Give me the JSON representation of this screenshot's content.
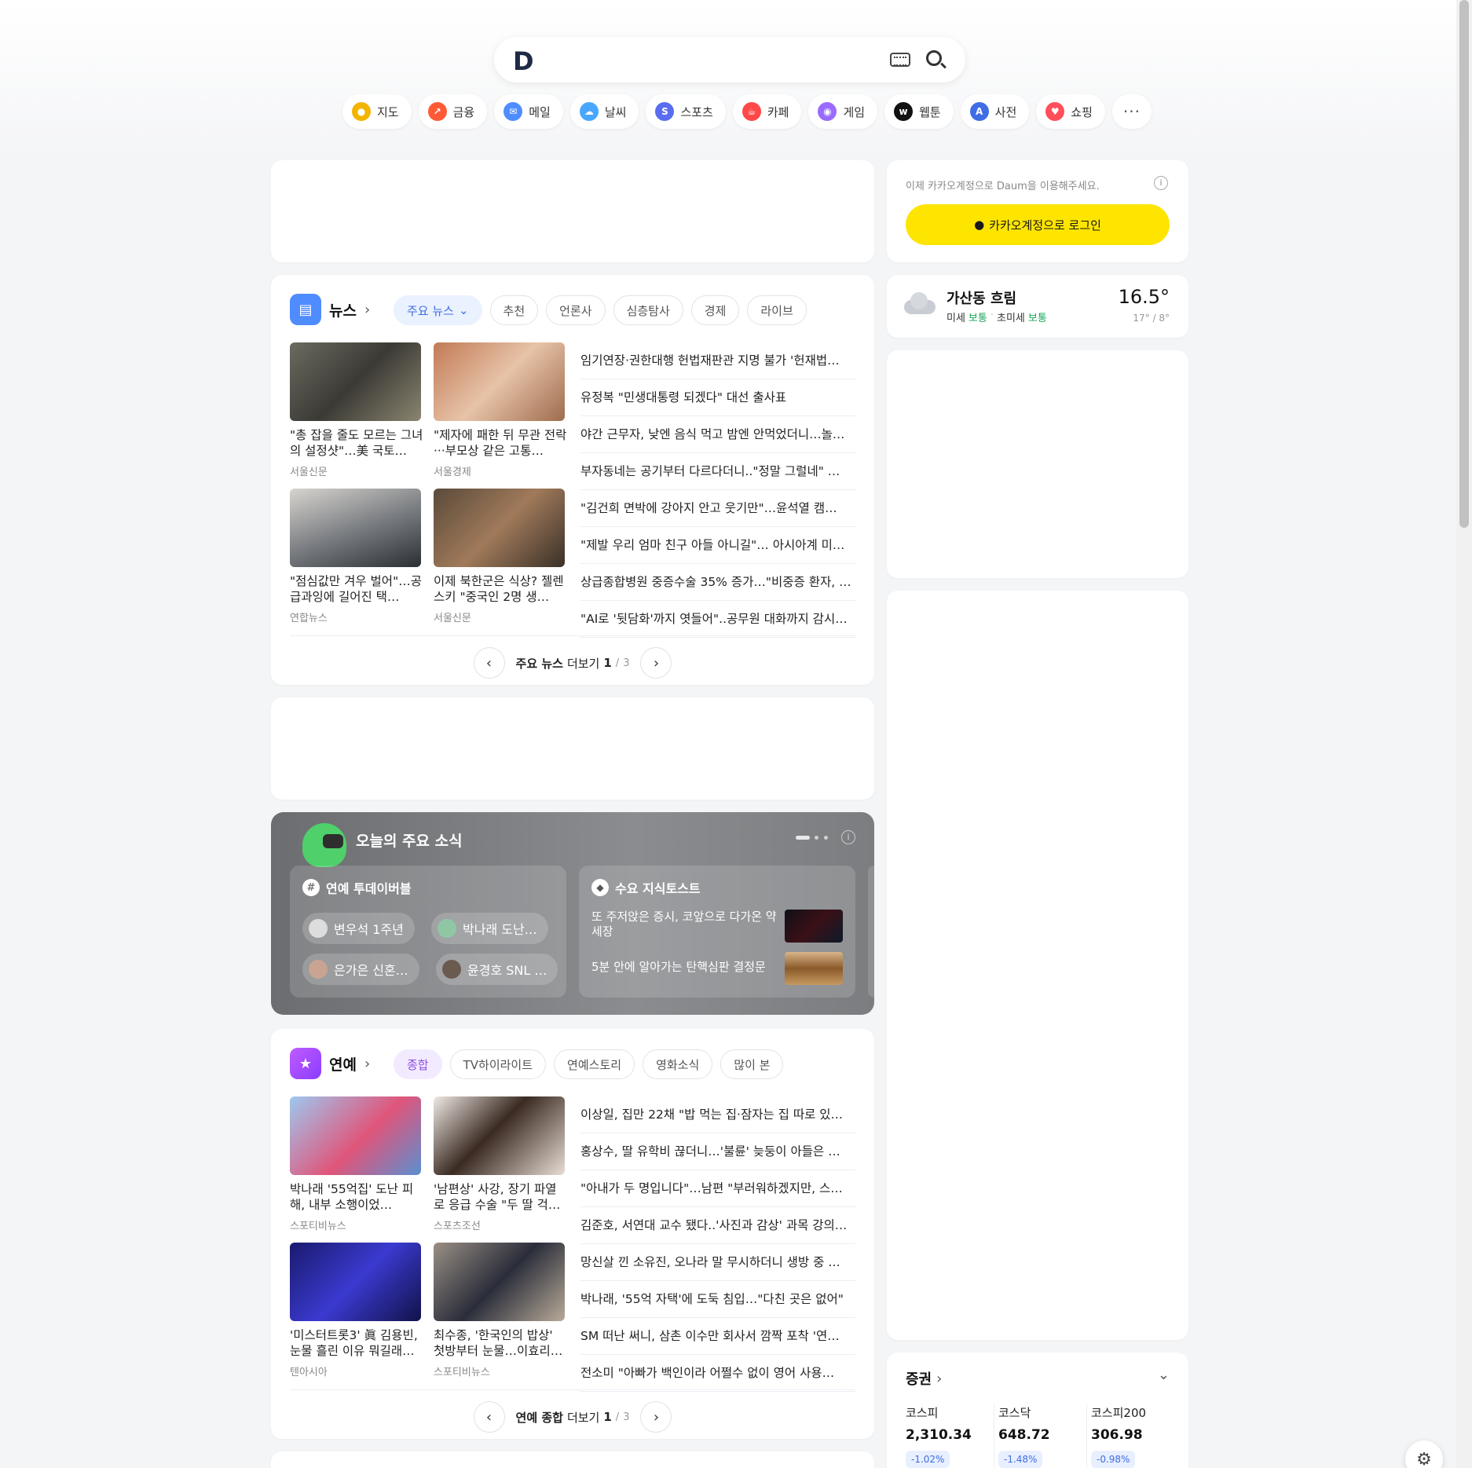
{
  "search": {
    "logo": "D"
  },
  "services": [
    {
      "label": "지도",
      "icon": "map-pin-icon",
      "color": "#f3b400",
      "glyph": "●"
    },
    {
      "label": "금융",
      "icon": "finance-icon",
      "color": "#ff5a36",
      "glyph": "↗"
    },
    {
      "label": "메일",
      "icon": "mail-icon",
      "color": "#4f8cff",
      "glyph": "✉"
    },
    {
      "label": "날씨",
      "icon": "weather-icon",
      "color": "#47a7ff",
      "glyph": "☁"
    },
    {
      "label": "스포츠",
      "icon": "sports-icon",
      "color": "#5a6cf0",
      "glyph": "S"
    },
    {
      "label": "카페",
      "icon": "cafe-icon",
      "color": "#ff4848",
      "glyph": "☕"
    },
    {
      "label": "게임",
      "icon": "game-icon",
      "color": "#9a6bff",
      "glyph": "◉"
    },
    {
      "label": "웹툰",
      "icon": "webtoon-icon",
      "color": "#111111",
      "glyph": "w"
    },
    {
      "label": "사전",
      "icon": "dictionary-icon",
      "color": "#3e6de4",
      "glyph": "A"
    },
    {
      "label": "쇼핑",
      "icon": "shopping-icon",
      "color": "#ff4f5a",
      "glyph": "♥"
    }
  ],
  "more_label": "···",
  "news": {
    "title": "뉴스",
    "tabs": [
      "주요 뉴스",
      "추천",
      "언론사",
      "심층탐사",
      "경제",
      "라이브"
    ],
    "cards": [
      {
        "caption": "\"총 잡을 줄도 모르는 그녀의 설정샷\"…美 국토…",
        "source": "서울신문"
      },
      {
        "caption": "\"제자에 패한 뒤 무관 전락···부모상 같은 고통…",
        "source": "서울경제"
      },
      {
        "caption": "\"점심값만 겨우 벌어\"…공급과잉에 길어진 택…",
        "source": "연합뉴스"
      },
      {
        "caption": "이제 북한군은 식상? 젤렌스키 \"중국인 2명 생…",
        "source": "서울신문"
      }
    ],
    "headlines": [
      "임기연장·권한대행 헌법재판관 지명 불가 '헌재법…",
      "유정복 \"민생대통령 되겠다\" 대선 출사표",
      "야간 근무자, 낮엔 음식 먹고 밤엔 안먹었더니…놀…",
      "부자동네는 공기부터 다르다더니..\"정말 그럴네\" …",
      "\"김건희 면박에 강아지 안고 웃기만\"…윤석열 캠…",
      "\"제발 우리 엄마 친구 아들 아니길\"… 아시아계 미…",
      "상급종합병원 중증수술 35% 증가…\"비중증 환자, …",
      "\"AI로 '뒷담화'까지 엿들어\"..공무원 대화까지 감시…"
    ],
    "pager": {
      "label": "주요 뉴스",
      "more": "더보기",
      "page": "1",
      "slash": "/",
      "total": "3"
    }
  },
  "today": {
    "title": "오늘의 주요 소식",
    "left_title": "연예 투데이버블",
    "chips": [
      "변우석 1주년",
      "박나래 도난…",
      "은가은 신혼…",
      "윤경호 SNL …"
    ],
    "right_title": "수요 지식토스트",
    "items": [
      "또 주저앉은 증시, 코앞으로 다가온 약세장",
      "5분 안에 알아가는 탄핵심판 결정문"
    ]
  },
  "ent": {
    "title": "연예",
    "tabs": [
      "종합",
      "TV하이라이트",
      "연예스토리",
      "영화소식",
      "많이 본"
    ],
    "cards": [
      {
        "caption": "박나래 '55억집' 도난 피해, 내부 소행이었…",
        "source": "스포티비뉴스"
      },
      {
        "caption": "'남편상' 사강, 장기 파열로 응급 수술 \"두 딸 걱…",
        "source": "스포츠조선"
      },
      {
        "caption": "'미스터트롯3' 眞 김용빈, 눈물 흘린 이유 뭐길래…",
        "source": "텐아시아"
      },
      {
        "caption": "최수종, '한국인의 밥상' 첫방부터 눈물…이효리…",
        "source": "스포티비뉴스"
      }
    ],
    "headlines": [
      "이상일, 집만 22채 \"밥 먹는 집·잠자는 집 따로 있…",
      "홍상수, 딸 유학비 끊더니…'불륜' 늦둥이 아들은 …",
      "\"아내가 두 명입니다\"…남편 \"부러워하겠지만, 스…",
      "김준호, 서연대 교수 됐다..'사진과 감상' 과목 강의…",
      "망신살 낀 소유진, 오나라 말 무시하더니 생방 중 …",
      "박나래, '55억 자택'에 도둑 침입…\"다친 곳은 없어\"",
      "SM 떠난 써니, 삼촌 이수만 회사서 깜짝 포착 '연…",
      "전소미 \"아빠가 백인이라 어쩔수 없이 영어 사용…"
    ],
    "pager": {
      "label": "연예 종합",
      "more": "더보기",
      "page": "1",
      "slash": "/",
      "total": "3"
    }
  },
  "login": {
    "notice": "이제 카카오계정으로 Daum을 이용해주세요.",
    "button": "카카오계정으로 로그인"
  },
  "weather": {
    "location": "가산동 흐림",
    "dust_label": "미세",
    "dust_value": "보통",
    "ultra_label": "초미세",
    "ultra_value": "보통",
    "temp": "16.5°",
    "range": "17° / 8°"
  },
  "stock": {
    "title": "증권",
    "items": [
      {
        "name": "코스피",
        "value": "2,310.34",
        "change": "-1.02%"
      },
      {
        "name": "코스닥",
        "value": "648.72",
        "change": "-1.48%"
      },
      {
        "name": "코스피200",
        "value": "306.98",
        "change": "-0.98%"
      }
    ]
  }
}
